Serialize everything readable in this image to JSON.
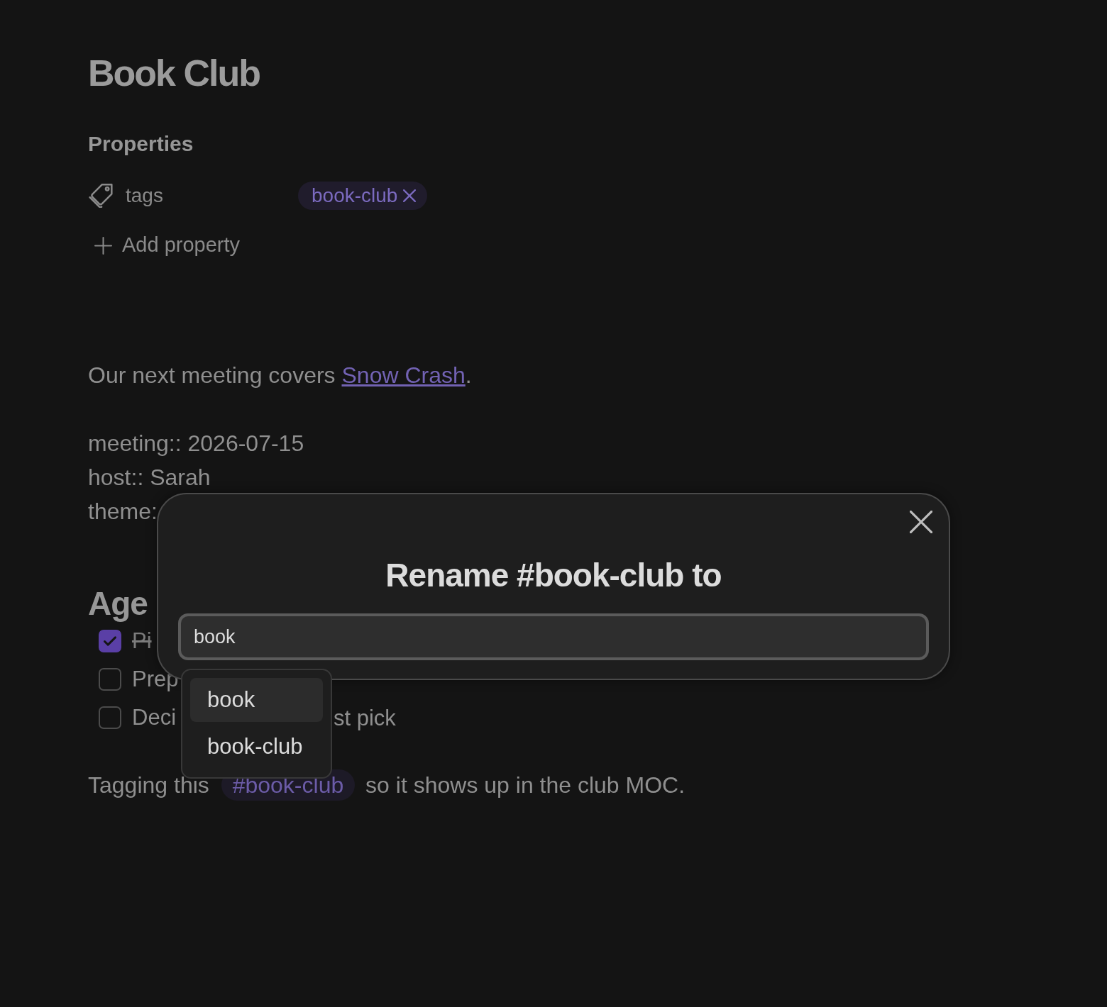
{
  "note": {
    "title": "Book Club"
  },
  "properties": {
    "heading": "Properties",
    "items": [
      {
        "name": "tags",
        "tags": [
          {
            "label": "book-club"
          }
        ]
      }
    ],
    "add_button": "Add property"
  },
  "paragraph": {
    "text": "Our next meeting covers ",
    "link": "Snow Crash",
    "after": "."
  },
  "inline_fields": [
    "meeting:: 2026-07-15",
    "host:: Sarah",
    "theme:"
  ],
  "agenda": {
    "heading": "Age",
    "tasks": [
      {
        "text": "Pi",
        "checked": true
      },
      {
        "text": "Prep",
        "checked": false
      },
      {
        "text": "Deci",
        "checked": false,
        "text_2": "st pick"
      }
    ]
  },
  "tag_line": {
    "before": "Tagging this",
    "tag": "#book-club",
    "after": "so it shows up in the club MOC."
  },
  "dialog": {
    "title": "Rename #book-club to",
    "input": {
      "value": "book"
    },
    "suggestions": [
      {
        "label": "book",
        "selected": true
      },
      {
        "label": "book-club",
        "selected": false
      }
    ]
  }
}
